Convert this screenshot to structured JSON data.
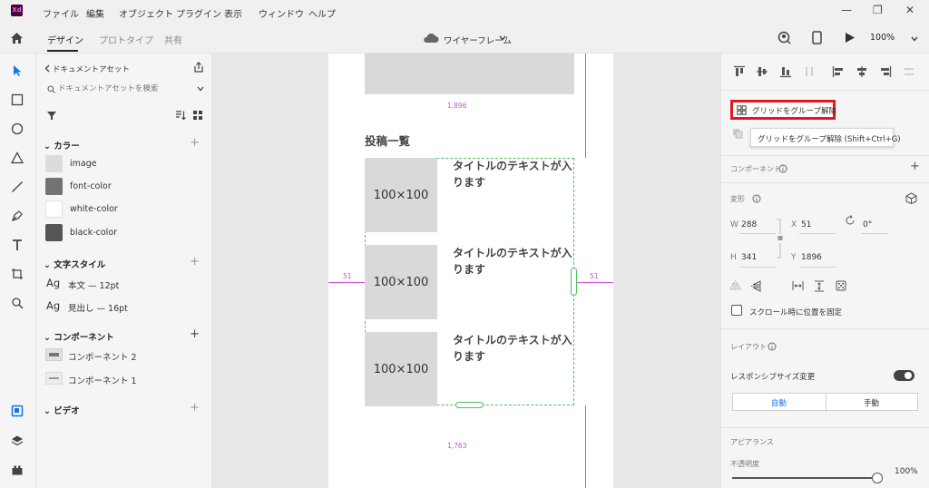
{
  "app": {
    "logo_text": "Xd"
  },
  "menu": [
    "ファイル",
    "編集",
    "オブジェクト",
    "プラグイン",
    "表示",
    "ウィンドウ",
    "ヘルプ"
  ],
  "window_controls": {
    "minimize": "—",
    "maximize": "❐",
    "close": "✕"
  },
  "toolbar": {
    "tabs": [
      "デザイン",
      "プロトタイプ",
      "共有"
    ],
    "document_name": "ワイヤーフレーム",
    "zoom": "100%"
  },
  "assets": {
    "back_label": "ドキュメントアセット",
    "search_placeholder": "ドキュメントアセットを検索",
    "colors_heading": "カラー",
    "colors": [
      {
        "name": "image",
        "hex": "#dcdcdc"
      },
      {
        "name": "font-color",
        "hex": "#737373"
      },
      {
        "name": "white-color",
        "hex": "#ffffff"
      },
      {
        "name": "black-color",
        "hex": "#555555"
      }
    ],
    "text_styles_heading": "文字スタイル",
    "text_styles": [
      {
        "sample": "Ag",
        "name": "本文 — 12pt"
      },
      {
        "sample": "Ag",
        "name": "見出し — 16pt"
      }
    ],
    "components_heading": "コンポーネント",
    "components": [
      "コンポーネント 2",
      "コンポーネント 1"
    ],
    "video_heading": "ビデオ"
  },
  "canvas": {
    "section_title": "投稿一覧",
    "cards": [
      {
        "thumb": "100×100",
        "title": "タイトルのテキストが入ります"
      },
      {
        "thumb": "100×100",
        "title": "タイトルのテキストが入ります"
      },
      {
        "thumb": "100×100",
        "title": "タイトルのテキストが入ります"
      }
    ],
    "guides": {
      "top": "1,896",
      "left": "51",
      "right": "51",
      "bottom": "1,763"
    }
  },
  "props": {
    "ungroup_button": "グリッドをグループ解除",
    "tooltip": "グリッドをグループ解除 (Shift+Ctrl+G)",
    "component_label": "コンポーネント",
    "transform_label": "変形",
    "w_label": "W",
    "w_value": "288",
    "x_label": "X",
    "x_value": "51",
    "h_label": "H",
    "h_value": "341",
    "y_label": "Y",
    "y_value": "1896",
    "rotation": "0°",
    "fix_scroll_label": "スクロール時に位置を固定",
    "layout_label": "レイアウト",
    "responsive_label": "レスポンシブサイズ変更",
    "auto_label": "自動",
    "manual_label": "手動",
    "appearance_label": "アピアランス",
    "opacity_label": "不透明度",
    "opacity_value": "100%",
    "accent": "#1473e6",
    "highlight": "#e3181c"
  }
}
